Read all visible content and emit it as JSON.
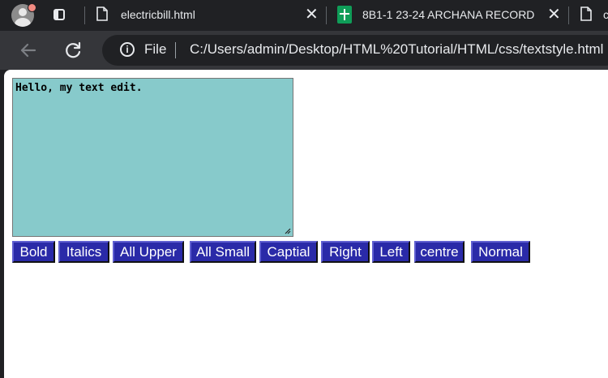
{
  "browser": {
    "tabs": [
      {
        "title": "electricbill.html",
        "icon": "document-icon",
        "close": "✕"
      },
      {
        "title": "8B1-1 23-24 ARCHANA RECORD",
        "icon": "sheets-icon",
        "close": "✕"
      },
      {
        "title": "c",
        "icon": "document-icon"
      }
    ],
    "address": {
      "scheme_label": "File",
      "url": "C:/Users/admin/Desktop/HTML%20Tutorial/HTML/css/textstyle.html"
    },
    "colors": {
      "frame": "#202124",
      "toolbar": "#35363a"
    }
  },
  "page": {
    "editor": {
      "value": "Hello, my text edit.",
      "background": "#87cacb"
    },
    "buttons": [
      {
        "label": "Bold"
      },
      {
        "label": "Italics"
      },
      {
        "label": "All Upper"
      },
      {
        "label": "All Small"
      },
      {
        "label": "Captial"
      },
      {
        "label": "Right"
      },
      {
        "label": "Left"
      },
      {
        "label": "centre"
      },
      {
        "label": "Normal"
      }
    ],
    "button_color": "#2a2aa8"
  }
}
